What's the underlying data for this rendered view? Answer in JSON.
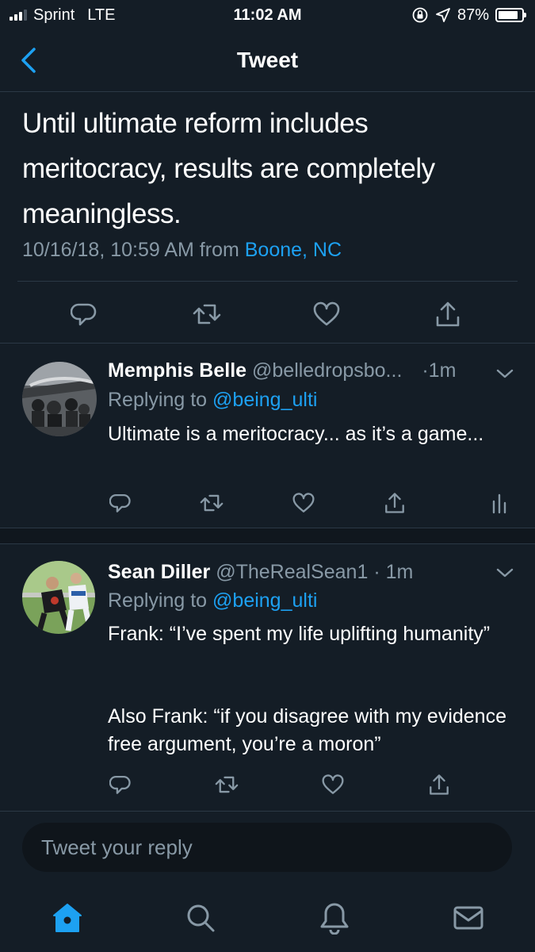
{
  "status_bar": {
    "carrier": "Sprint",
    "network": "LTE",
    "time": "11:02 AM",
    "battery": "87%",
    "battery_level": 0.87
  },
  "header": {
    "title": "Tweet"
  },
  "main_tweet": {
    "text": "Until ultimate reform includes meritocracy, results are completely meaningless.",
    "timestamp": "10/16/18, 10:59 AM",
    "from_label": "from",
    "location": "Boone, NC"
  },
  "replies": [
    {
      "name": "Memphis Belle",
      "handle": "@belledropsbo...",
      "time": "·1m",
      "replying_label": "Replying to",
      "replying_to": "@being_ulti",
      "text": "Ultimate is a meritocracy... as it’s a game..."
    },
    {
      "name": "Sean Diller",
      "handle": "@TheRealSean1",
      "time": "· 1m",
      "replying_label": "Replying to",
      "replying_to": "@being_ulti",
      "text_line1": "Frank: “I’ve spent my life uplifting humanity”",
      "text_line2": "Also Frank: “if you disagree with my evidence free argument, you’re a moron”"
    }
  ],
  "composer": {
    "placeholder": "Tweet your reply"
  },
  "colors": {
    "background": "#141d26",
    "accent": "#1da1f2",
    "muted": "#8899a6",
    "divider": "#2b3845"
  }
}
